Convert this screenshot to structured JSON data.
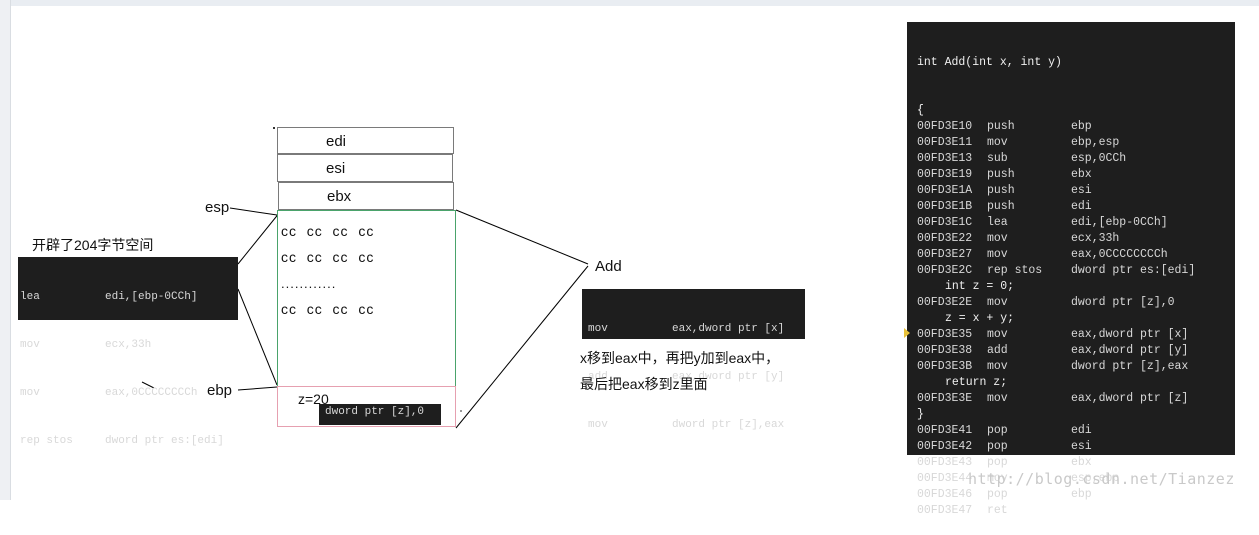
{
  "registers": [
    "edi",
    "esi",
    "ebx"
  ],
  "pointer_labels": {
    "esp": "esp",
    "ebp": "ebp"
  },
  "cc_rows": [
    "cc  cc  cc  cc",
    "cc  cc  cc  cc",
    "cc  cc  cc  cc"
  ],
  "ellipsis": "............",
  "z_label": "z=20",
  "z_instruction": "dword ptr [z],0",
  "alloc_note": "开辟了204字节空间",
  "alloc_code": [
    [
      "lea",
      "edi,[ebp-0CCh]"
    ],
    [
      "mov",
      "ecx,33h"
    ],
    [
      "mov",
      "eax,0CCCCCCCCh"
    ],
    [
      "rep stos",
      "dword ptr es:[edi]"
    ]
  ],
  "add_label": "Add",
  "add_code": [
    [
      "mov",
      "eax,dword ptr [x]"
    ],
    [
      "add",
      "eax,dword ptr [y]"
    ],
    [
      "mov",
      "dword ptr [z],eax"
    ]
  ],
  "add_note_1": "x移到eax中，再把y加到eax中，",
  "add_note_2": "最后把eax移到z里面",
  "disasm": {
    "header": "int Add(int x, int y)",
    "lines": [
      {
        "kind": "src",
        "text": "{"
      },
      {
        "kind": "asm",
        "addr": "00FD3E10",
        "op": "push",
        "arg": "ebp"
      },
      {
        "kind": "asm",
        "addr": "00FD3E11",
        "op": "mov",
        "arg": "ebp,esp"
      },
      {
        "kind": "asm",
        "addr": "00FD3E13",
        "op": "sub",
        "arg": "esp,0CCh"
      },
      {
        "kind": "asm",
        "addr": "00FD3E19",
        "op": "push",
        "arg": "ebx"
      },
      {
        "kind": "asm",
        "addr": "00FD3E1A",
        "op": "push",
        "arg": "esi"
      },
      {
        "kind": "asm",
        "addr": "00FD3E1B",
        "op": "push",
        "arg": "edi"
      },
      {
        "kind": "asm",
        "addr": "00FD3E1C",
        "op": "lea",
        "arg": "edi,[ebp-0CCh]"
      },
      {
        "kind": "asm",
        "addr": "00FD3E22",
        "op": "mov",
        "arg": "ecx,33h"
      },
      {
        "kind": "asm",
        "addr": "00FD3E27",
        "op": "mov",
        "arg": "eax,0CCCCCCCCh"
      },
      {
        "kind": "asm",
        "addr": "00FD3E2C",
        "op": "rep stos",
        "arg": "dword ptr es:[edi]"
      },
      {
        "kind": "srci",
        "text": "int z = 0;"
      },
      {
        "kind": "asm",
        "addr": "00FD3E2E",
        "op": "mov",
        "arg": "dword ptr [z],0"
      },
      {
        "kind": "srci",
        "text": "z = x + y;"
      },
      {
        "kind": "asm",
        "addr": "00FD3E35",
        "op": "mov",
        "arg": "eax,dword ptr [x]"
      },
      {
        "kind": "asm",
        "addr": "00FD3E38",
        "op": "add",
        "arg": "eax,dword ptr [y]"
      },
      {
        "kind": "asm",
        "addr": "00FD3E3B",
        "op": "mov",
        "arg": "dword ptr [z],eax"
      },
      {
        "kind": "srci",
        "text": "return z;"
      },
      {
        "kind": "asm",
        "addr": "00FD3E3E",
        "op": "mov",
        "arg": "eax,dword ptr [z]"
      },
      {
        "kind": "src",
        "text": "}"
      },
      {
        "kind": "asm",
        "addr": "00FD3E41",
        "op": "pop",
        "arg": "edi"
      },
      {
        "kind": "asm",
        "addr": "00FD3E42",
        "op": "pop",
        "arg": "esi"
      },
      {
        "kind": "asm",
        "addr": "00FD3E43",
        "op": "pop",
        "arg": "ebx"
      },
      {
        "kind": "asm",
        "addr": "00FD3E44",
        "op": "mov",
        "arg": "esp,ebp"
      },
      {
        "kind": "asm",
        "addr": "00FD3E46",
        "op": "pop",
        "arg": "ebp"
      },
      {
        "kind": "asm",
        "addr": "00FD3E47",
        "op": "ret",
        "arg": ""
      }
    ]
  },
  "watermark": "http://blog.csdn.net/Tianzez"
}
